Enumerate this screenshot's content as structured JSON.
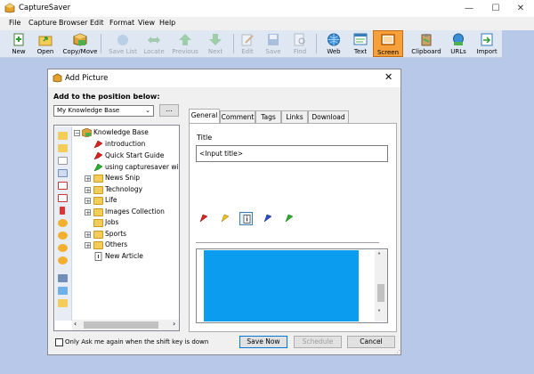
{
  "app": {
    "title": "CaptureSaver"
  },
  "window_controls": {
    "minimize": "—",
    "maximize": "☐",
    "close": "✕"
  },
  "menu": [
    "File",
    "Capture",
    "Browser",
    "Edit",
    "Format",
    "View",
    "Help"
  ],
  "toolbar": [
    {
      "label": "New",
      "icon": "new-icon",
      "enabled": true
    },
    {
      "label": "Open",
      "icon": "open-folder-icon",
      "enabled": true
    },
    {
      "label": "Copy/Move",
      "icon": "copy-move-icon",
      "enabled": true
    },
    {
      "label": "Save List",
      "icon": "save-list-icon",
      "enabled": false
    },
    {
      "label": "Locate",
      "icon": "locate-icon",
      "enabled": false
    },
    {
      "label": "Previous",
      "icon": "previous-icon",
      "enabled": false
    },
    {
      "label": "Next",
      "icon": "next-icon",
      "enabled": false
    },
    {
      "label": "Edit",
      "icon": "edit-icon",
      "enabled": false
    },
    {
      "label": "Save",
      "icon": "save-icon",
      "enabled": false
    },
    {
      "label": "Find",
      "icon": "find-icon",
      "enabled": false
    },
    {
      "label": "Web",
      "icon": "web-icon",
      "enabled": true
    },
    {
      "label": "Text",
      "icon": "text-icon",
      "enabled": true
    },
    {
      "label": "Screen",
      "icon": "screen-icon",
      "enabled": true,
      "active": true
    },
    {
      "label": "Clipboard",
      "icon": "clipboard-icon",
      "enabled": true
    },
    {
      "label": "URLs",
      "icon": "urls-icon",
      "enabled": true
    },
    {
      "label": "Import",
      "icon": "import-icon",
      "enabled": true
    }
  ],
  "dialog": {
    "title": "Add Picture",
    "close": "✕",
    "position_label": "Add to the position below:",
    "position_value": "My Knowledge Base",
    "browse_label": "...",
    "tree": [
      {
        "label": "Knowledge Base",
        "icon": "knowledge-base-icon",
        "expander": "−"
      },
      {
        "label": "introduction",
        "icon": "red-flag-icon"
      },
      {
        "label": "Quick Start Guide",
        "icon": "red-flag-icon"
      },
      {
        "label": "using capturesaver with",
        "icon": "green-flag-icon"
      },
      {
        "label": "News Snip",
        "icon": "folder-icon",
        "expander": "+"
      },
      {
        "label": "Technology",
        "icon": "folder-icon",
        "expander": "+"
      },
      {
        "label": "Life",
        "icon": "folder-icon",
        "expander": "+"
      },
      {
        "label": "Images Collection",
        "icon": "folder-icon",
        "expander": "+"
      },
      {
        "label": "Jobs",
        "icon": "folder-icon"
      },
      {
        "label": "Sports",
        "icon": "folder-icon",
        "expander": "+"
      },
      {
        "label": "Others",
        "icon": "folder-icon",
        "expander": "+"
      },
      {
        "label": "New Article",
        "icon": "article-icon"
      }
    ],
    "tabs": [
      "General",
      "Comment",
      "Tags",
      "Links",
      "Download"
    ],
    "active_tab": "General",
    "title_label": "Title",
    "title_value": "<Input title>",
    "flags": [
      "red-flag-icon",
      "yellow-flag-icon",
      "info-flag-icon",
      "blue-flag-icon",
      "green-flag-icon"
    ],
    "checkbox_label": "Only Ask me again when the shift key is down",
    "buttons": {
      "save_now": "Save Now",
      "schedule": "Schedule",
      "cancel": "Cancel"
    }
  }
}
